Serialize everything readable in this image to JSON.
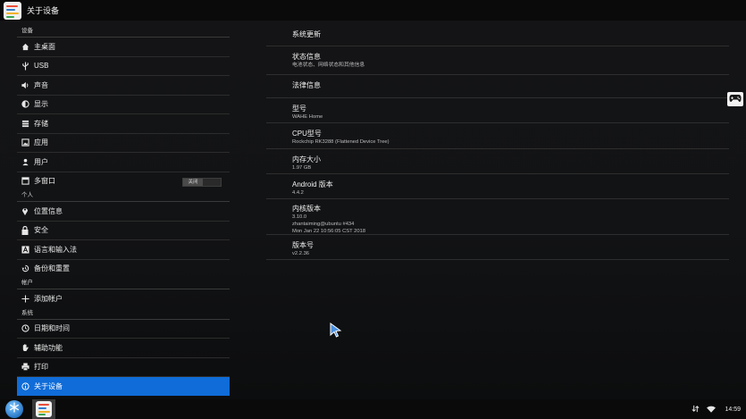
{
  "window": {
    "title": "关于设备"
  },
  "sidebar": {
    "categories": {
      "device": "设备",
      "personal": "个人",
      "accounts": "帐户",
      "system": "系统"
    },
    "items": {
      "home": "主桌面",
      "usb": "USB",
      "sound": "声音",
      "display": "显示",
      "storage": "存储",
      "apps": "应用",
      "users": "用户",
      "multiwindow": "多窗口",
      "location": "位置信息",
      "security": "安全",
      "language": "语言和输入法",
      "backup": "备份和重置",
      "add_account": "添加帐户",
      "datetime": "日期和时间",
      "accessibility": "辅助功能",
      "print": "打印",
      "about": "关于设备"
    },
    "multiwindow_toggle": "关闭"
  },
  "details": {
    "system_update": "系统更新",
    "status": {
      "title": "状态信息",
      "summary": "电池状态、网络状态和其他信息"
    },
    "legal": "法律信息",
    "model": {
      "title": "型号",
      "value": "WAHE Home"
    },
    "cpu": {
      "title": "CPU型号",
      "value": "Rockchip RK3288 (Flattened Device Tree)"
    },
    "memory": {
      "title": "内存大小",
      "value": "1.97 GB"
    },
    "android": {
      "title": "Android 版本",
      "value": "4.4.2"
    },
    "kernel": {
      "title": "内核版本",
      "lines": [
        "3.10.0",
        "zhantaiming@ubuntu #434",
        "Mon Jan 22 10:56:05 CST 2018"
      ]
    },
    "build": {
      "title": "版本号",
      "value": "v2.2.36"
    }
  },
  "taskbar": {
    "clock": "14:59"
  },
  "colors": {
    "accent": "#0f6cd8",
    "background": "#121315"
  }
}
